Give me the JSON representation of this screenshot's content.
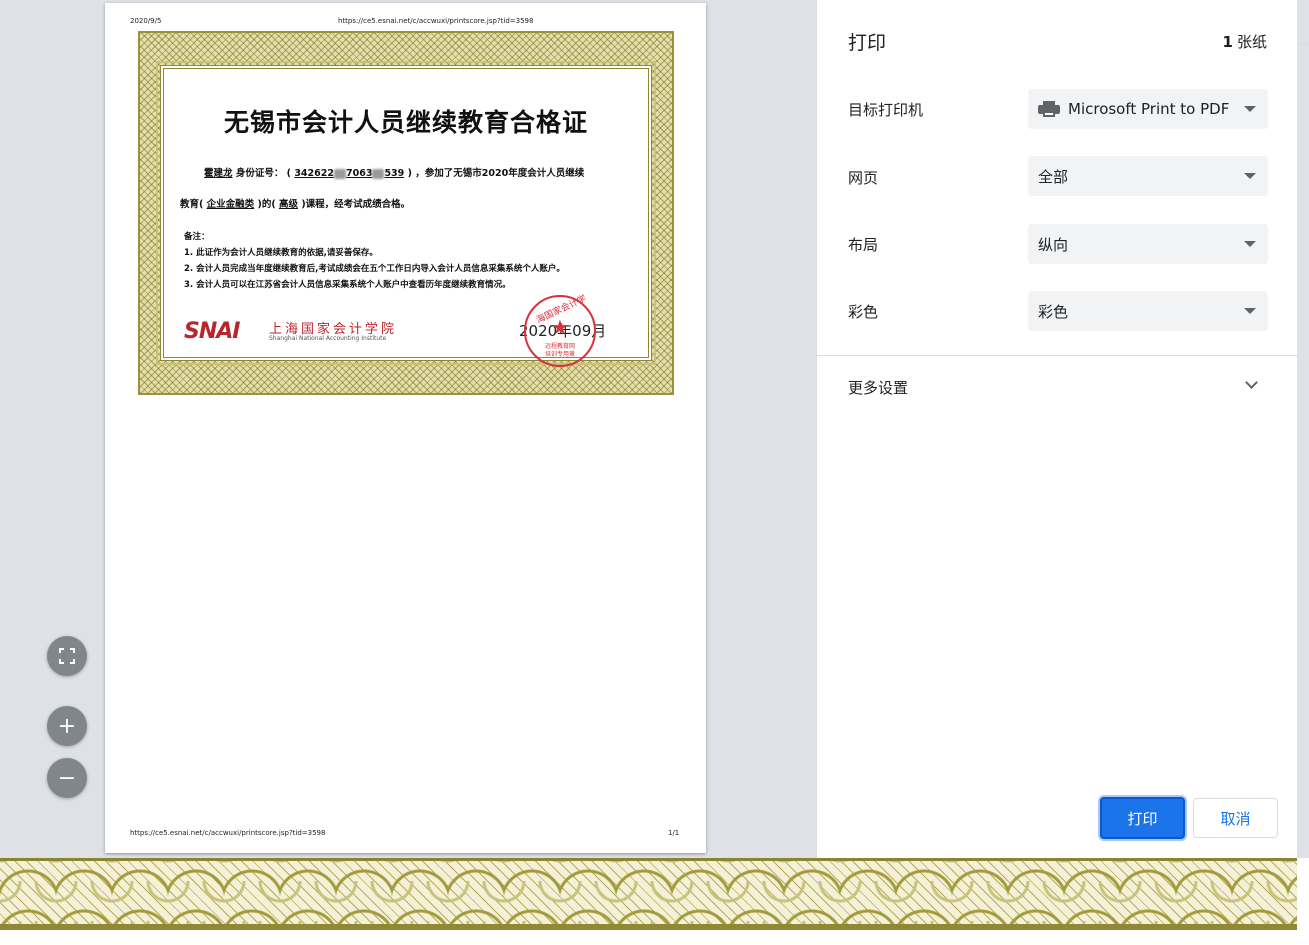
{
  "preview": {
    "header_date": "2020/9/5",
    "header_url": "https://ce5.esnai.net/c/accwuxi/printscore.jsp?tid=3598",
    "footer_url": "https://ce5.esnai.net/c/accwuxi/printscore.jsp?tid=3598",
    "page_number": "1/1"
  },
  "certificate": {
    "title": "无锡市会计人员继续教育合格证",
    "name": "霍建龙",
    "id_label": "身份证号：",
    "id_part1": "342622",
    "id_part2": "7063",
    "id_part3": "539",
    "line1_tail": "，参加了无锡市2020年度会计人员继续",
    "line2_prefix": "教育(",
    "course_type": "企业金融类",
    "line2_mid": ")的(",
    "level": "高级",
    "line2_tail": ")课程，经考试成绩合格。",
    "notes_title": "备注：",
    "notes": [
      "1. 此证作为会计人员继续教育的依据,请妥善保存。",
      "2. 会计人员完成当年度继续教育后,考试成绩会在五个工作日内导入会计人员信息采集系统个人账户。",
      "3. 会计人员可以在江苏省会计人员信息采集系统个人账户中查看历年度继续教育情况。"
    ],
    "logo_mark": "SNAI",
    "logo_cn": "上海国家会计学院",
    "logo_en": "Shanghai National Accounting Institute",
    "stamp_arc": "海国家会计学",
    "stamp_line1": "远程教育网",
    "stamp_line2": "培训专用章",
    "issue_date": "2020年09月"
  },
  "zoom": {
    "fit_icon": "fit-to-page-icon",
    "zoom_in": "+",
    "zoom_out": "−"
  },
  "sidebar": {
    "title": "打印",
    "sheet_count": "1",
    "sheet_unit": "张纸",
    "destination_label": "目标打印机",
    "destination_value": "Microsoft Print to PDF",
    "pages_label": "网页",
    "pages_value": "全部",
    "layout_label": "布局",
    "layout_value": "纵向",
    "color_label": "彩色",
    "color_value": "彩色",
    "more_settings": "更多设置",
    "print_button": "打印",
    "cancel_button": "取消"
  },
  "colors": {
    "accent": "#1a73e8",
    "stamp": "#d8323b",
    "cert_border": "#9a9238"
  }
}
